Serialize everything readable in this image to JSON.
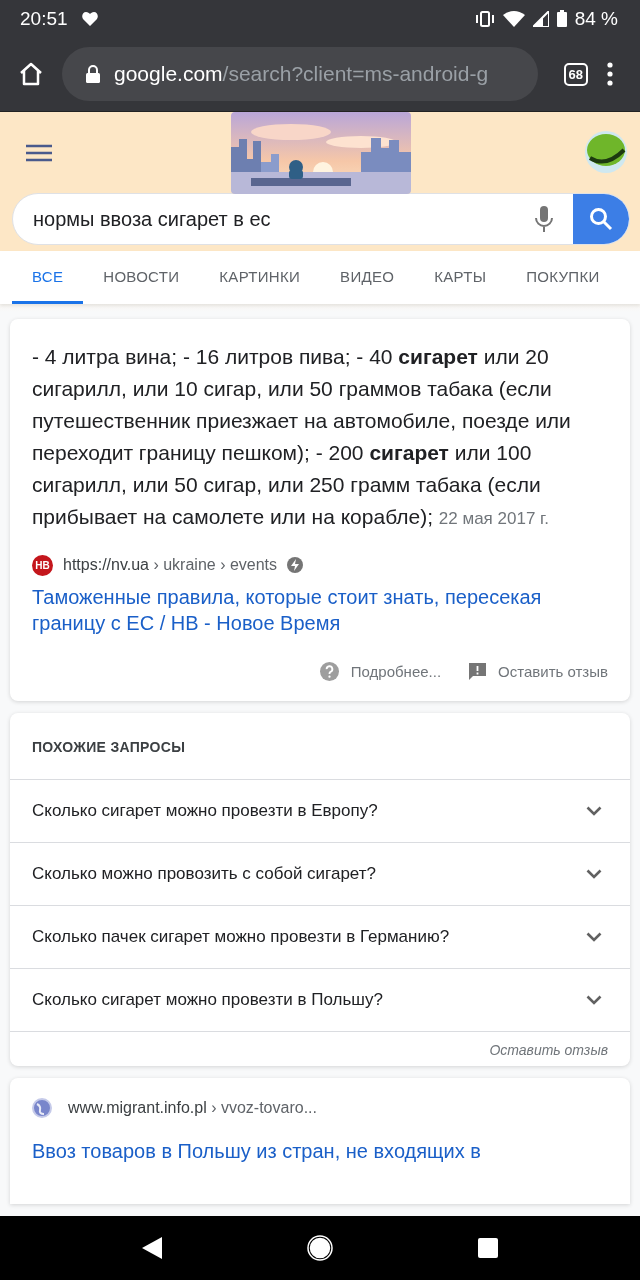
{
  "status_bar": {
    "time": "20:51",
    "battery": "84 %"
  },
  "browser": {
    "url_host": "google.com",
    "url_path": "/search?client=ms-android-g",
    "tab_count": "68"
  },
  "search": {
    "value": "нормы ввоза сигарет в ес"
  },
  "tabs": [
    {
      "label": "ВСЕ",
      "selected": true
    },
    {
      "label": "НОВОСТИ",
      "selected": false
    },
    {
      "label": "КАРТИНКИ",
      "selected": false
    },
    {
      "label": "ВИДЕО",
      "selected": false
    },
    {
      "label": "КАРТЫ",
      "selected": false
    },
    {
      "label": "ПОКУПКИ",
      "selected": false
    }
  ],
  "featured": {
    "snippet": "- 4 литра вина; - 16 литров пива; - 40 **сигарет** или 20 сигарилл, или 10 сигар, или 50 граммов табака (если путешественник приезжает на автомобиле, поезде или переходит границу пешком); - 200 **сигарет** или 100 сигарилл, или 50 сигар, или 250 грамм табака (если прибывает на самолете или на корабле);",
    "date": "22 мая 2017 г.",
    "site_badge": "НВ",
    "url": "https://nv.ua",
    "breadcrumb": " › ukraine › events",
    "title": "Таможенные правила, которые стоит знать, пересекая границу с ЕС / НВ - Новое Время",
    "more": "Подробнее...",
    "feedback": "Оставить отзыв"
  },
  "related": {
    "heading": "ПОХОЖИЕ ЗАПРОСЫ",
    "items": [
      {
        "text": "Сколько сигарет можно провезти в Европу?",
        "expanded": false
      },
      {
        "text": "Сколько можно провозить с собой сигарет?",
        "expanded": false
      },
      {
        "text": "Сколько пачек сигарет можно провезти в Германию?",
        "expanded": false
      },
      {
        "text": "Сколько сигарет можно провезти в Польшу?",
        "expanded": false
      }
    ],
    "feedback": "Оставить отзыв"
  },
  "result": {
    "url": "www.migrant.info.pl",
    "breadcrumb": " › vvoz-tovaro...",
    "title": "Ввоз товаров в Польшу из стран, не входящих в"
  }
}
